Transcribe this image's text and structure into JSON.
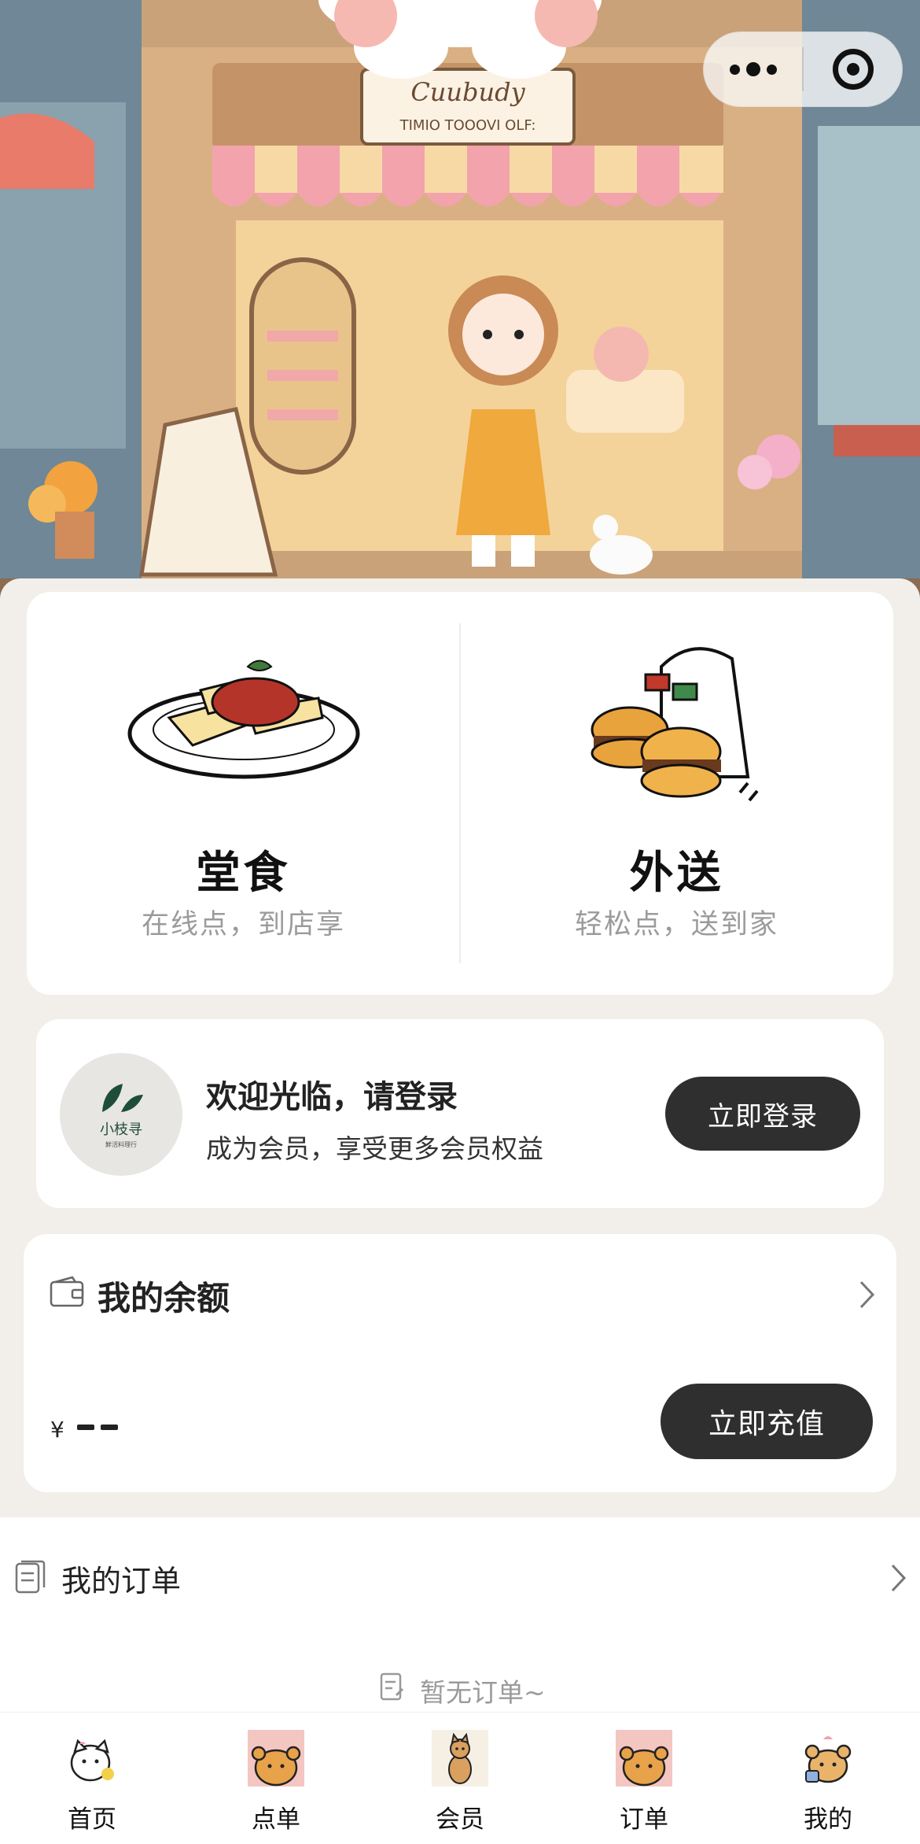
{
  "hero": {
    "shop_sign_line1": "Cuubudy",
    "shop_sign_line2": "TIMIO TOOOVI OLF:"
  },
  "service_modes": [
    {
      "title": "堂食",
      "subtitle": "在线点，到店享",
      "icon": "pasta-plate-icon"
    },
    {
      "title": "外送",
      "subtitle": "轻松点，送到家",
      "icon": "burger-bag-icon"
    }
  ],
  "login": {
    "logo_text": "小枝寻",
    "logo_small": "鮮活料理行",
    "title": "欢迎光临，请登录",
    "subtitle": "成为会员，享受更多会员权益",
    "button": "立即登录"
  },
  "balance": {
    "title": "我的余额",
    "currency": "¥",
    "amount_placeholder": "--",
    "button": "立即充值"
  },
  "orders": {
    "title": "我的订单",
    "empty_text": "暂无订单~"
  },
  "tabbar": [
    {
      "label": "首页",
      "icon": "cat-home-icon"
    },
    {
      "label": "点单",
      "icon": "bear-order-icon"
    },
    {
      "label": "会员",
      "icon": "dog-member-icon"
    },
    {
      "label": "订单",
      "icon": "bear-orders-icon"
    },
    {
      "label": "我的",
      "icon": "bear-profile-icon"
    }
  ],
  "colors": {
    "page_bg": "#f2efea",
    "card_bg": "#ffffff",
    "button_dark": "#2f2f2f",
    "muted_text": "#9b9b9b"
  }
}
